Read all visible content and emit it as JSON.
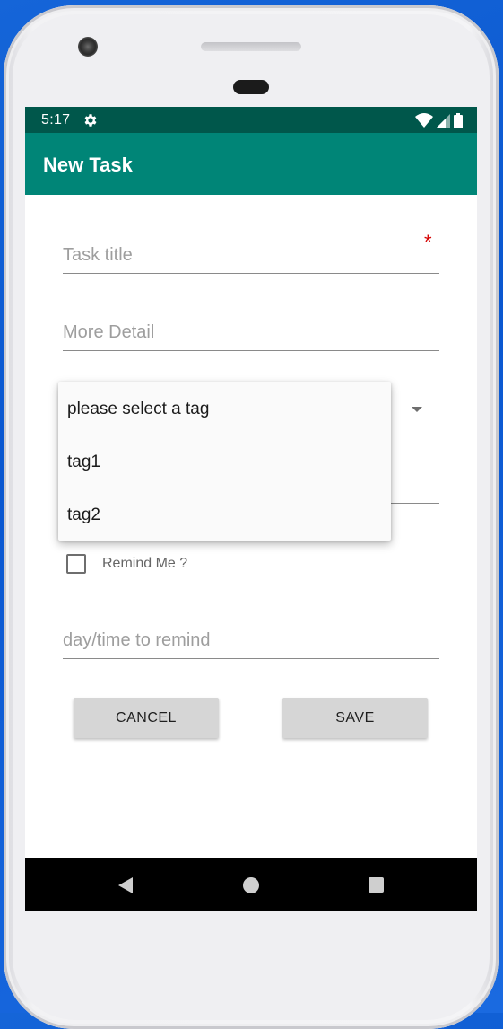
{
  "status_bar": {
    "time": "5:17",
    "icons": [
      "settings-gear-icon",
      "wifi-icon",
      "signal-icon",
      "battery-icon"
    ]
  },
  "app_bar": {
    "title": "New Task"
  },
  "form": {
    "title_field": {
      "placeholder": "Task title",
      "required_mark": "*"
    },
    "detail_field": {
      "placeholder": "More Detail"
    },
    "tag_dropdown": {
      "options": [
        "please select a tag",
        "tag1",
        "tag2"
      ]
    },
    "remind_checkbox": {
      "label": "Remind Me ?",
      "checked": false
    },
    "remind_field": {
      "placeholder": "day/time to remind"
    }
  },
  "buttons": {
    "cancel": "CANCEL",
    "save": "SAVE"
  },
  "nav_bar": {
    "icons": [
      "back-icon",
      "home-icon",
      "recents-icon"
    ]
  },
  "colors": {
    "status_bar": "#00574b",
    "app_bar": "#008577",
    "required_mark": "#d50000",
    "button_bg": "#d6d6d6"
  }
}
